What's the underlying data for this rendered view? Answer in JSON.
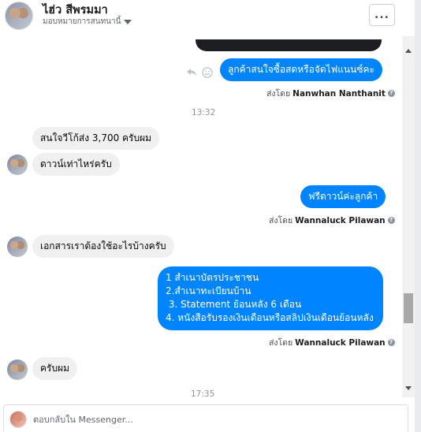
{
  "header": {
    "name": "ไฮ่ว สีพรมมา",
    "subtitle": "มอบหมายการสนทนานี้",
    "more_label": "..."
  },
  "messages": [
    {
      "text": "ลูกค้าสนใจซื้อสดหรือจัดไฟแนนซ์คะ"
    },
    {
      "text": "สนใจวีโก้ส่ง 3,700 ครับผม"
    },
    {
      "text": "ดาวน์เท่าไหร่ครับ"
    },
    {
      "text": "ฟรีดาวน์ค่ะลูกค้า"
    },
    {
      "text": "เอกสารเราต้องใช้อะไรบ้างครับ"
    },
    {
      "lines": [
        "1 สำเนาบัตรประชาชน",
        "2.สำเนาทะเบียนบ้าน",
        " 3. Statement ย้อนหลัง 6 เดือน",
        "4. หนังสือรับรองเงินเดือนหรือสลิปเงินเดือนย้อนหลัง"
      ]
    },
    {
      "text": "ครับผม"
    }
  ],
  "sent_by": [
    {
      "prefix": "ส่งโดย",
      "name": "Nanwhan Nanthanit"
    },
    {
      "prefix": "ส่งโดย",
      "name": "Wannaluck Pilawan"
    },
    {
      "prefix": "ส่งโดย",
      "name": "Wannaluck Pilawan"
    }
  ],
  "timestamps": [
    "13:32",
    "17:35"
  ],
  "composer": {
    "placeholder": "ตอบกลับใน Messenger..."
  },
  "colors": {
    "outgoing_bubble": "#0084ff",
    "incoming_bubble": "#f1f0f0"
  },
  "icons": [
    "more-icon",
    "reply-icon",
    "emoji-icon",
    "help-icon",
    "caret-down-icon"
  ]
}
